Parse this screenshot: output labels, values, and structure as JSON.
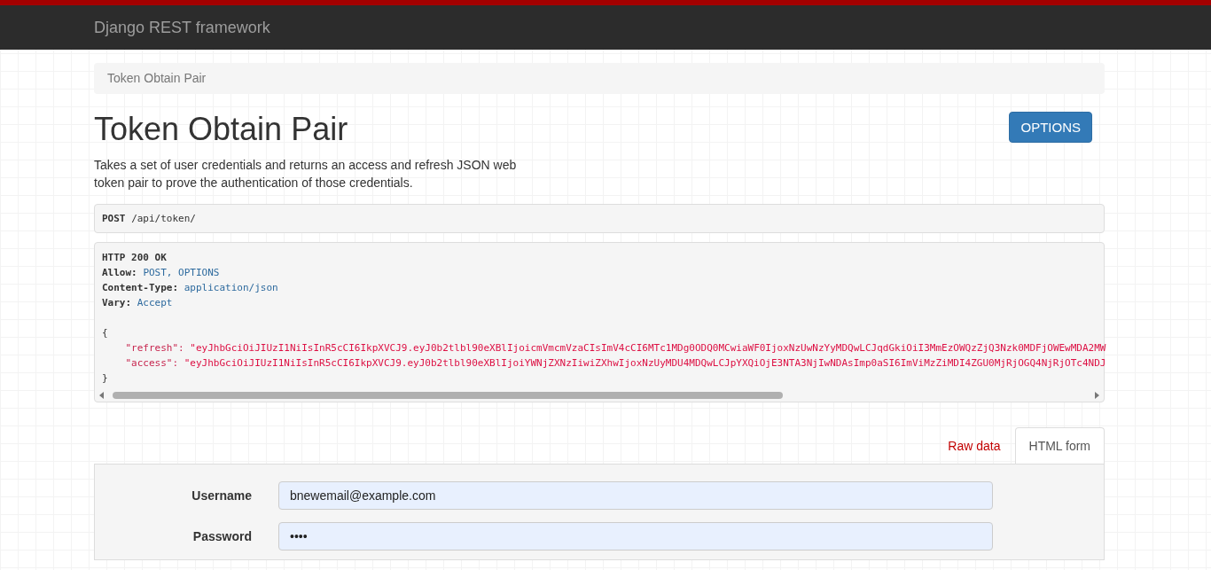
{
  "navbar": {
    "brand": "Django REST framework"
  },
  "breadcrumb": [
    "Token Obtain Pair"
  ],
  "page": {
    "title": "Token Obtain Pair",
    "options_button": "OPTIONS",
    "description": "Takes a set of user credentials and returns an access and refresh JSON web token pair to prove the authentication of those credentials."
  },
  "request": {
    "method": "POST",
    "path": "/api/token/"
  },
  "response": {
    "status": "HTTP 200 OK",
    "headers": [
      {
        "name": "Allow:",
        "value": "POST, OPTIONS"
      },
      {
        "name": "Content-Type:",
        "value": "application/json"
      },
      {
        "name": "Vary:",
        "value": "Accept"
      }
    ],
    "open_brace": "{",
    "close_brace": "}",
    "fields": [
      {
        "key": "\"refresh\":",
        "value": "\"eyJhbGciOiJIUzI1NiIsInR5cCI6IkpXVCJ9.eyJ0b2tlbl90eXBlIjoicmVmcmVzaCIsImV4cCI6MTc1MDg0ODQ0MCwiaWF0IjoxNzUwNzYyMDQwLCJqdGkiOiI3MmEzOWQzZjQ3Nzk0MDFjOWEwMDA2MW"
      },
      {
        "key": "\"access\":",
        "value": "\"eyJhbGciOiJIUzI1NiIsInR5cCI6IkpXVCJ9.eyJ0b2tlbl90eXBlIjoiYWNjZXNzIiwiZXhwIjoxNzUyMDU4MDQwLCJpYXQiOjE3NTA3NjIwNDAsImp0aSI6ImViMzZiMDI4ZGU0MjRjOGQ4NjRjOTc4NDJ"
      }
    ]
  },
  "tabs": [
    {
      "label": "Raw data",
      "selected": false
    },
    {
      "label": "HTML form",
      "selected": true
    }
  ],
  "form": {
    "fields": [
      {
        "label": "Username",
        "value": "bnewemail@example.com"
      },
      {
        "label": "Password",
        "value": "••••"
      }
    ]
  }
}
